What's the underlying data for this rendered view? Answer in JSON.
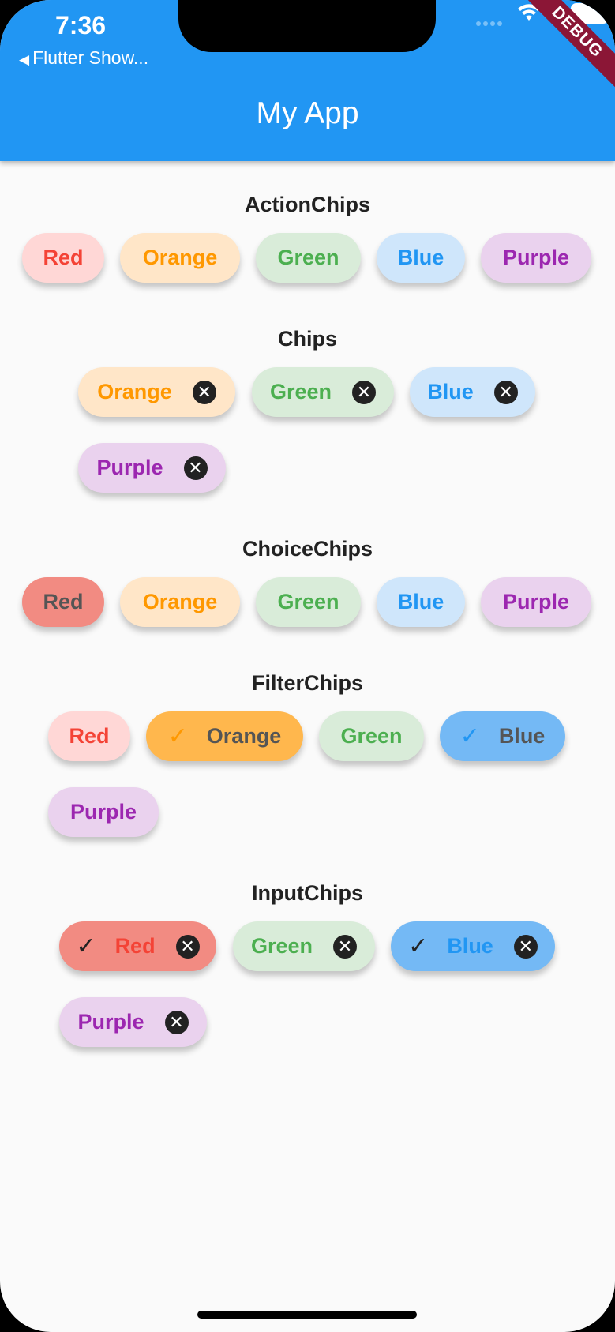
{
  "status_bar": {
    "time": "7:36",
    "back_label": "Flutter Show...",
    "debug_banner": "DEBUG"
  },
  "app_bar": {
    "title": "My App"
  },
  "colors": {
    "app_bar": "#2196f3",
    "red": "#f44336",
    "orange": "#ff9800",
    "green": "#4caf50",
    "blue": "#2196f3",
    "purple": "#9c27b0"
  },
  "sections": {
    "action_chips": {
      "title": "ActionChips",
      "chips": [
        {
          "label": "Red"
        },
        {
          "label": "Orange"
        },
        {
          "label": "Green"
        },
        {
          "label": "Blue"
        },
        {
          "label": "Purple"
        }
      ]
    },
    "chips": {
      "title": "Chips",
      "chips": [
        {
          "label": "Orange",
          "deletable": true
        },
        {
          "label": "Green",
          "deletable": true
        },
        {
          "label": "Blue",
          "deletable": true
        },
        {
          "label": "Purple",
          "deletable": true
        }
      ]
    },
    "choice_chips": {
      "title": "ChoiceChips",
      "chips": [
        {
          "label": "Red",
          "selected": true
        },
        {
          "label": "Orange",
          "selected": false
        },
        {
          "label": "Green",
          "selected": false
        },
        {
          "label": "Blue",
          "selected": false
        },
        {
          "label": "Purple",
          "selected": false
        }
      ]
    },
    "filter_chips": {
      "title": "FilterChips",
      "chips": [
        {
          "label": "Red",
          "selected": false
        },
        {
          "label": "Orange",
          "selected": true
        },
        {
          "label": "Green",
          "selected": false
        },
        {
          "label": "Blue",
          "selected": true
        },
        {
          "label": "Purple",
          "selected": false
        }
      ]
    },
    "input_chips": {
      "title": "InputChips",
      "chips": [
        {
          "label": "Red",
          "selected": true,
          "deletable": true
        },
        {
          "label": "Green",
          "selected": false,
          "deletable": true
        },
        {
          "label": "Blue",
          "selected": true,
          "deletable": true
        },
        {
          "label": "Purple",
          "selected": false,
          "deletable": true
        }
      ]
    }
  },
  "icons": {
    "delete": "close-circle-icon",
    "check": "check-icon",
    "wifi": "wifi-icon",
    "battery": "battery-icon",
    "back": "back-arrow-icon"
  }
}
